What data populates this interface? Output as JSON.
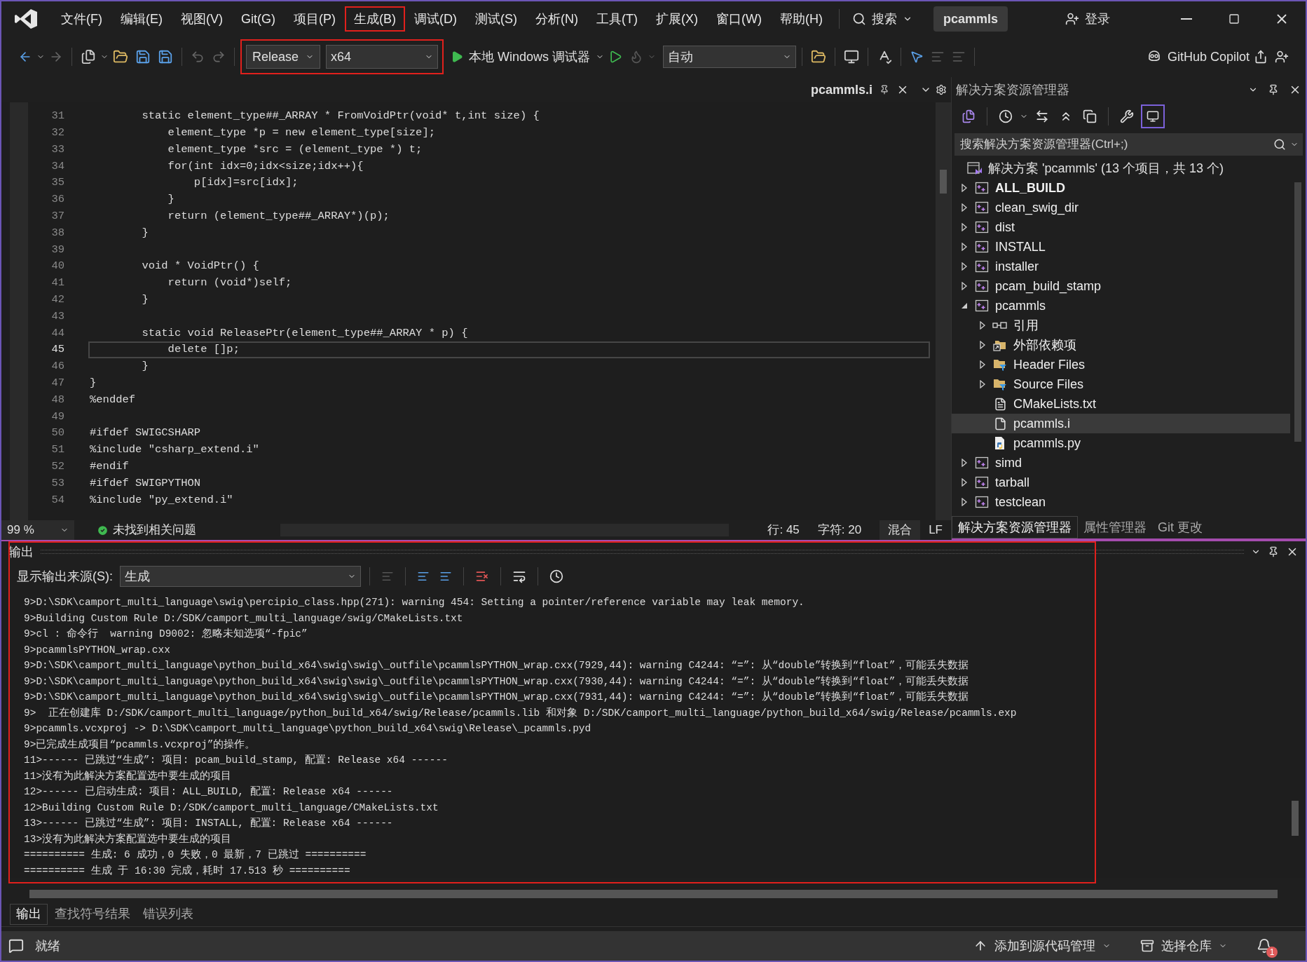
{
  "menu": [
    {
      "label": "文件(F)",
      "highlighted": false
    },
    {
      "label": "编辑(E)",
      "highlighted": false
    },
    {
      "label": "视图(V)",
      "highlighted": false
    },
    {
      "label": "Git(G)",
      "highlighted": false
    },
    {
      "label": "项目(P)",
      "highlighted": false
    },
    {
      "label": "生成(B)",
      "highlighted": true
    },
    {
      "label": "调试(D)",
      "highlighted": false
    },
    {
      "label": "测试(S)",
      "highlighted": false
    },
    {
      "label": "分析(N)",
      "highlighted": false
    },
    {
      "label": "工具(T)",
      "highlighted": false
    },
    {
      "label": "扩展(X)",
      "highlighted": false
    },
    {
      "label": "窗口(W)",
      "highlighted": false
    },
    {
      "label": "帮助(H)",
      "highlighted": false
    }
  ],
  "search": {
    "label": "搜索"
  },
  "solution_name": "pcammls",
  "sign_in": "登录",
  "toolbar": {
    "configuration": "Release",
    "platform": "x64",
    "config_highlighted": true,
    "debugger": "本地 Windows 调试器",
    "mode": "自动",
    "copilot": "GitHub Copilot"
  },
  "document_tab": {
    "title": "pcammls.i"
  },
  "editor": {
    "lines": [
      {
        "number": "31",
        "text": "        static element_type##_ARRAY * FromVoidPtr(void* t,int size) {",
        "current": false
      },
      {
        "number": "32",
        "text": "            element_type *p = new element_type[size];",
        "current": false
      },
      {
        "number": "33",
        "text": "            element_type *src = (element_type *) t;",
        "current": false
      },
      {
        "number": "34",
        "text": "            for(int idx=0;idx<size;idx++){",
        "current": false
      },
      {
        "number": "35",
        "text": "                p[idx]=src[idx];",
        "current": false
      },
      {
        "number": "36",
        "text": "            }",
        "current": false
      },
      {
        "number": "37",
        "text": "            return (element_type##_ARRAY*)(p);",
        "current": false
      },
      {
        "number": "38",
        "text": "        }",
        "current": false
      },
      {
        "number": "39",
        "current": false
      },
      {
        "number": "40",
        "text": "        void * VoidPtr() {",
        "current": false
      },
      {
        "number": "41",
        "text": "            return (void*)self;",
        "current": false
      },
      {
        "number": "42",
        "text": "        }",
        "current": false
      },
      {
        "number": "43",
        "current": false
      },
      {
        "number": "44",
        "text": "        static void ReleasePtr(element_type##_ARRAY * p) {",
        "current": false
      },
      {
        "number": "45",
        "text": "            delete []p;",
        "current": true
      },
      {
        "number": "46",
        "text": "        }",
        "current": false
      },
      {
        "number": "47",
        "text": "}",
        "current": false
      },
      {
        "number": "48",
        "text": "%enddef",
        "current": false
      },
      {
        "number": "49",
        "current": false
      },
      {
        "number": "50",
        "text": "#ifdef SWIGCSHARP",
        "current": false
      },
      {
        "number": "51",
        "text": "%include \"csharp_extend.i\"",
        "current": false
      },
      {
        "number": "52",
        "text": "#endif",
        "current": false
      },
      {
        "number": "53",
        "text": "#ifdef SWIGPYTHON",
        "current": false
      },
      {
        "number": "54",
        "text": "%include \"py_extend.i\"",
        "current": false
      }
    ],
    "zoom": "99 %",
    "issues": "未找到相关问题",
    "row": "行: 45",
    "column": "字符: 20",
    "indent": "混合",
    "line_ending": "LF"
  },
  "solution_explorer": {
    "title": "解决方案资源管理器",
    "search_placeholder": "搜索解决方案资源管理器(Ctrl+;)",
    "solution": "解决方案 'pcammls' (13 个项目，共 13 个)",
    "items": [
      {
        "label": "ALL_BUILD",
        "kind": "project",
        "expanded": false,
        "startup": true,
        "selected": false
      },
      {
        "label": "clean_swig_dir",
        "kind": "project",
        "expanded": false,
        "startup": false,
        "selected": false
      },
      {
        "label": "dist",
        "kind": "project",
        "expanded": false,
        "startup": false,
        "selected": false
      },
      {
        "label": "INSTALL",
        "kind": "project",
        "expanded": false,
        "startup": false,
        "selected": false
      },
      {
        "label": "installer",
        "kind": "project",
        "expanded": false,
        "startup": false,
        "selected": false
      },
      {
        "label": "pcam_build_stamp",
        "kind": "project",
        "expanded": false,
        "startup": false,
        "selected": false
      },
      {
        "label": "pcammls",
        "kind": "project",
        "expanded": true,
        "startup": false,
        "selected": false,
        "children": [
          {
            "label": "引用",
            "kind": "references",
            "expanded": false,
            "startup": false,
            "selected": false
          },
          {
            "label": "外部依赖项",
            "kind": "external",
            "expanded": false,
            "startup": false,
            "selected": false
          },
          {
            "label": "Header Files",
            "kind": "filter",
            "expanded": false,
            "startup": false,
            "selected": false
          },
          {
            "label": "Source Files",
            "kind": "filter",
            "expanded": false,
            "startup": false,
            "selected": false
          },
          {
            "label": "CMakeLists.txt",
            "kind": "text",
            "startup": false,
            "selected": false
          },
          {
            "label": "pcammls.i",
            "kind": "file",
            "startup": false,
            "selected": true
          },
          {
            "label": "pcammls.py",
            "kind": "python",
            "startup": false,
            "selected": false
          }
        ]
      },
      {
        "label": "simd",
        "kind": "project",
        "expanded": false,
        "startup": false,
        "selected": false
      },
      {
        "label": "tarball",
        "kind": "project",
        "expanded": false,
        "startup": false,
        "selected": false
      },
      {
        "label": "testclean",
        "kind": "project",
        "expanded": false,
        "startup": false,
        "selected": false
      }
    ],
    "tabs": [
      {
        "label": "解决方案资源管理器",
        "selected": true
      },
      {
        "label": "属性管理器",
        "selected": false
      },
      {
        "label": "Git 更改",
        "selected": false
      }
    ]
  },
  "output": {
    "title": "输出",
    "highlighted": true,
    "source_label": "显示输出来源(S):",
    "source": "生成",
    "lines": [
      "9>D:\\SDK\\camport_multi_language\\swig\\percipio_class.hpp(271): warning 454: Setting a pointer/reference variable may leak memory.",
      "9>Building Custom Rule D:/SDK/camport_multi_language/swig/CMakeLists.txt",
      "9>cl : 命令行  warning D9002: 忽略未知选项“-fpic”",
      "9>pcammlsPYTHON_wrap.cxx",
      "9>D:\\SDK\\camport_multi_language\\python_build_x64\\swig\\swig\\_outfile\\pcammlsPYTHON_wrap.cxx(7929,44): warning C4244: “=”: 从“double”转换到“float”，可能丢失数据",
      "9>D:\\SDK\\camport_multi_language\\python_build_x64\\swig\\swig\\_outfile\\pcammlsPYTHON_wrap.cxx(7930,44): warning C4244: “=”: 从“double”转换到“float”，可能丢失数据",
      "9>D:\\SDK\\camport_multi_language\\python_build_x64\\swig\\swig\\_outfile\\pcammlsPYTHON_wrap.cxx(7931,44): warning C4244: “=”: 从“double”转换到“float”，可能丢失数据",
      "9>  正在创建库 D:/SDK/camport_multi_language/python_build_x64/swig/Release/pcammls.lib 和对象 D:/SDK/camport_multi_language/python_build_x64/swig/Release/pcammls.exp",
      "9>pcammls.vcxproj -> D:\\SDK\\camport_multi_language\\python_build_x64\\swig\\Release\\_pcammls.pyd",
      "9>已完成生成项目“pcammls.vcxproj”的操作。",
      "11>------ 已跳过“生成”: 项目: pcam_build_stamp, 配置: Release x64 ------",
      "11>没有为此解决方案配置选中要生成的项目",
      "12>------ 已启动生成: 项目: ALL_BUILD, 配置: Release x64 ------",
      "12>Building Custom Rule D:/SDK/camport_multi_language/CMakeLists.txt",
      "13>------ 已跳过“生成”: 项目: INSTALL, 配置: Release x64 ------",
      "13>没有为此解决方案配置选中要生成的项目",
      "========== 生成: 6 成功，0 失败，0 最新，7 已跳过 ==========",
      "========== 生成 于 16:30 完成，耗时 17.513 秒 =========="
    ],
    "tabs": [
      {
        "label": "输出",
        "selected": true
      },
      {
        "label": "查找符号结果",
        "selected": false
      },
      {
        "label": "错误列表",
        "selected": false
      }
    ]
  },
  "status_bar": {
    "state": "就绪",
    "source_control": "添加到源代码管理",
    "repository": "选择仓库",
    "notifications": "1"
  }
}
